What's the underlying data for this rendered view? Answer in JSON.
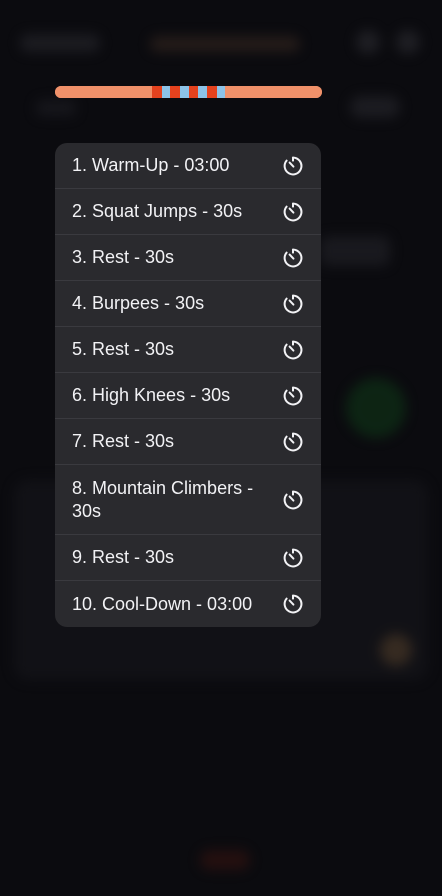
{
  "progress": {
    "segments": [
      {
        "color": "#f0916a",
        "weight": 79
      },
      {
        "color": "#e4421e",
        "weight": 8
      },
      {
        "color": "#8cc3e8",
        "weight": 7
      },
      {
        "color": "#e4421e",
        "weight": 8
      },
      {
        "color": "#8cc3e8",
        "weight": 7
      },
      {
        "color": "#e4421e",
        "weight": 8
      },
      {
        "color": "#8cc3e8",
        "weight": 7
      },
      {
        "color": "#e4421e",
        "weight": 8
      },
      {
        "color": "#8cc3e8",
        "weight": 7
      },
      {
        "color": "#f0916a",
        "weight": 79
      }
    ]
  },
  "workout": {
    "items": [
      {
        "label": "1. Warm-Up - 03:00",
        "icon": "timer-icon"
      },
      {
        "label": "2. Squat Jumps - 30s",
        "icon": "timer-icon"
      },
      {
        "label": "3. Rest - 30s",
        "icon": "timer-icon"
      },
      {
        "label": "4. Burpees - 30s",
        "icon": "timer-icon"
      },
      {
        "label": "5. Rest - 30s",
        "icon": "timer-icon"
      },
      {
        "label": "6. High Knees - 30s",
        "icon": "timer-icon"
      },
      {
        "label": "7. Rest - 30s",
        "icon": "timer-icon"
      },
      {
        "label": "8. Mountain Climbers - 30s",
        "icon": "timer-icon"
      },
      {
        "label": "9. Rest - 30s",
        "icon": "timer-icon"
      },
      {
        "label": "10. Cool-Down - 03:00",
        "icon": "timer-icon"
      }
    ]
  }
}
